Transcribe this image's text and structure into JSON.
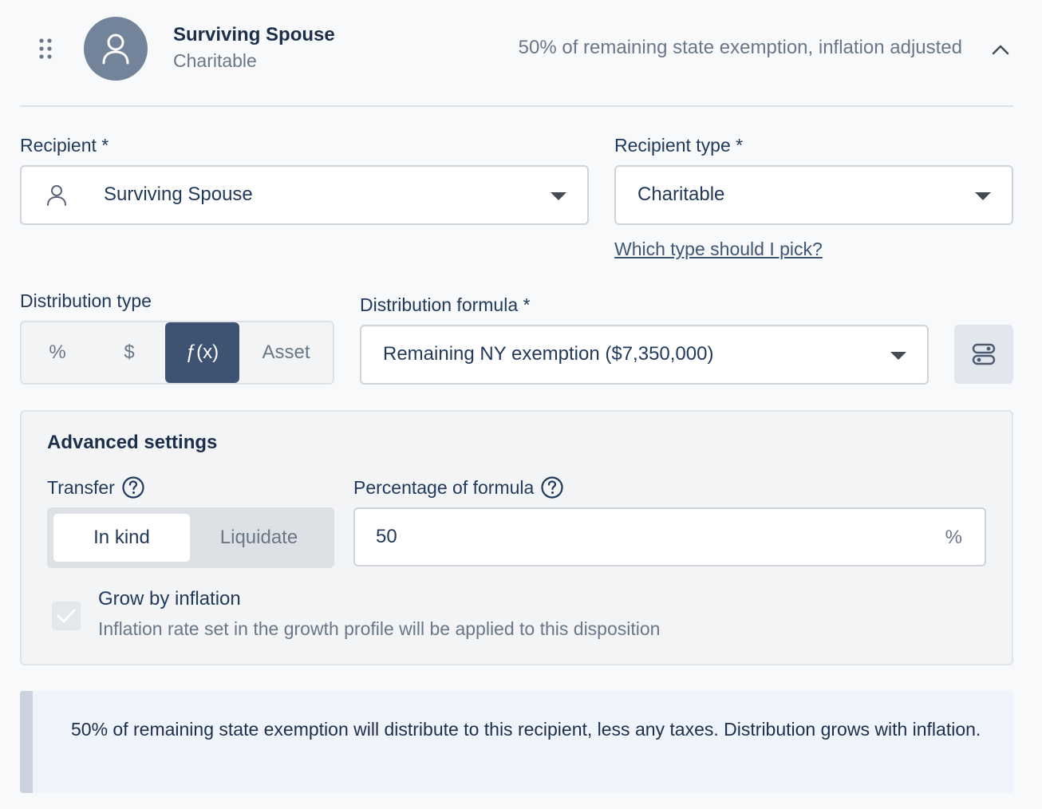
{
  "header": {
    "name": "Surviving Spouse",
    "type": "Charitable",
    "summary": "50% of remaining state exemption, inflation adjusted"
  },
  "recipient": {
    "label": "Recipient *",
    "value": "Surviving Spouse"
  },
  "recipient_type": {
    "label": "Recipient type *",
    "value": "Charitable",
    "help_link": "Which type should I pick?"
  },
  "distribution_type": {
    "label": "Distribution type",
    "options": [
      "%",
      "$",
      "ƒ(x)",
      "Asset"
    ],
    "selected": "ƒ(x)"
  },
  "distribution_formula": {
    "label": "Distribution formula *",
    "value": "Remaining NY exemption ($7,350,000)"
  },
  "advanced": {
    "title": "Advanced settings",
    "transfer": {
      "label": "Transfer",
      "options": [
        "In kind",
        "Liquidate"
      ],
      "selected": "In kind"
    },
    "percentage": {
      "label": "Percentage of formula",
      "value": "50",
      "suffix": "%"
    },
    "grow_by_inflation": {
      "label": "Grow by inflation",
      "description": "Inflation rate set in the growth profile will be applied to this disposition",
      "checked": true
    }
  },
  "banner": {
    "text": "50% of remaining state exemption will distribute to this recipient, less any taxes. Distribution grows with inflation."
  },
  "icons": {
    "drag": "drag-handle-icon",
    "avatar": "user-icon",
    "collapse": "chevron-up-icon",
    "formula_settings": "settings-sliders-icon",
    "help": "question-circle-icon"
  },
  "colors": {
    "accent": "#3e5373",
    "avatar_bg": "#738399",
    "banner_bg": "#eff4fb",
    "banner_border": "#c9d2de"
  }
}
